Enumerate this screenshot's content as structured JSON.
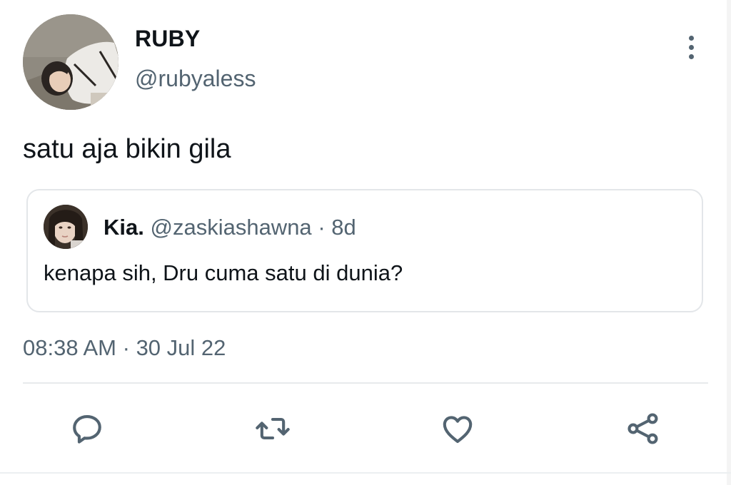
{
  "tweet": {
    "author": {
      "display_name": "RUBY",
      "handle": "@rubyaless"
    },
    "text": "satu aja bikin gila",
    "timestamp": {
      "time": "08:38 AM",
      "separator": "·",
      "date": "30 Jul 22"
    }
  },
  "quoted_tweet": {
    "display_name": "Kia.",
    "handle": "@zaskiashawna",
    "separator": "·",
    "age": "8d",
    "text": "kenapa sih, Dru cuma satu di dunia?"
  },
  "icons": {
    "more": "more-vertical-icon",
    "reply": "reply-icon",
    "retweet": "retweet-icon",
    "like": "heart-icon",
    "share": "share-icon"
  },
  "colors": {
    "text_primary": "#0f1419",
    "text_secondary": "#536471",
    "border": "#e3e6e9"
  }
}
